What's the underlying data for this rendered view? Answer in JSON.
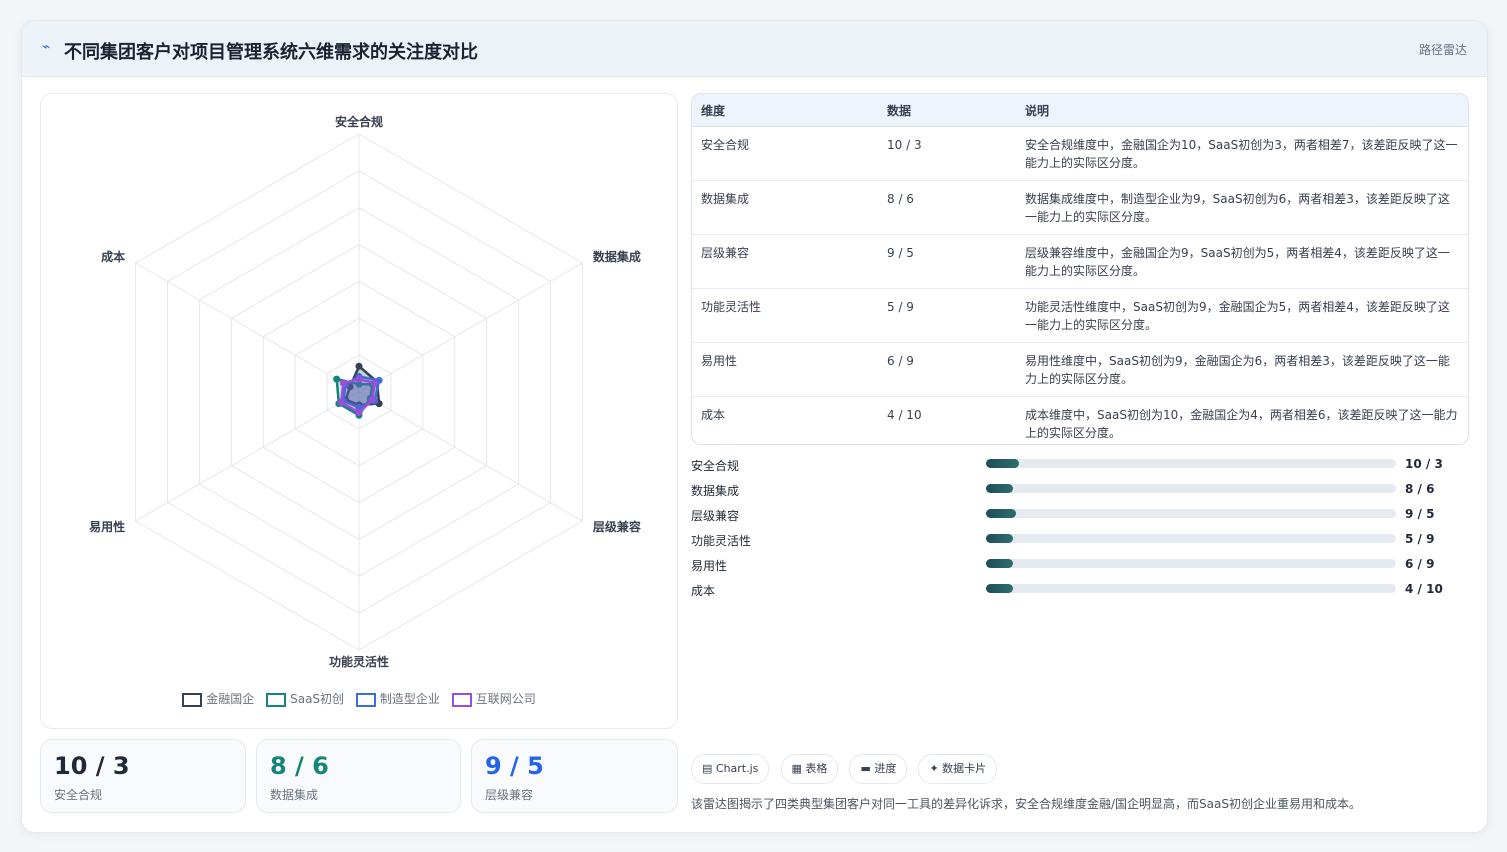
{
  "header": {
    "title": "不同集团客户对项目管理系统六维需求的关注度对比",
    "tag": "路径雷达",
    "icon": "chart-line-icon"
  },
  "chart_data": {
    "type": "radar",
    "axes": [
      "安全合规",
      "数据集成",
      "层级兼容",
      "功能灵活性",
      "易用性",
      "成本"
    ],
    "rmax": 100,
    "rings": 7,
    "series": [
      {
        "name": "金融国企",
        "color": "#334155",
        "values": [
          10,
          8,
          9,
          5,
          6,
          4
        ]
      },
      {
        "name": "SaaS初创",
        "color": "#14857a",
        "values": [
          3,
          6,
          5,
          9,
          9,
          10
        ]
      },
      {
        "name": "制造型企业",
        "color": "#3b6fd6",
        "values": [
          6,
          9,
          7,
          6,
          7,
          6
        ]
      },
      {
        "name": "互联网公司",
        "color": "#9b4ddb",
        "values": [
          5,
          7,
          6,
          8,
          8,
          7
        ]
      }
    ]
  },
  "table": {
    "headers": [
      "维度",
      "数据",
      "说明"
    ],
    "rows": [
      {
        "dim": "安全合规",
        "data": "10 / 3",
        "desc": "安全合规维度中，金融国企为10，SaaS初创为3，两者相差7，该差距反映了这一能力上的实际区分度。"
      },
      {
        "dim": "数据集成",
        "data": "8 / 6",
        "desc": "数据集成维度中，制造型企业为9，SaaS初创为6，两者相差3，该差距反映了这一能力上的实际区分度。"
      },
      {
        "dim": "层级兼容",
        "data": "9 / 5",
        "desc": "层级兼容维度中，金融国企为9，SaaS初创为5，两者相差4，该差距反映了这一能力上的实际区分度。"
      },
      {
        "dim": "功能灵活性",
        "data": "5 / 9",
        "desc": "功能灵活性维度中，SaaS初创为9，金融国企为5，两者相差4，该差距反映了这一能力上的实际区分度。"
      },
      {
        "dim": "易用性",
        "data": "6 / 9",
        "desc": "易用性维度中，SaaS初创为9，金融国企为6，两者相差3，该差距反映了这一能力上的实际区分度。"
      },
      {
        "dim": "成本",
        "data": "4 / 10",
        "desc": "成本维度中，SaaS初创为10，金融国企为4，两者相差6，该差距反映了这一能力上的实际区分度。"
      }
    ]
  },
  "bars": [
    {
      "label": "安全合规",
      "value": "10 / 3",
      "fill": 0.08
    },
    {
      "label": "数据集成",
      "value": "8 / 6",
      "fill": 0.065
    },
    {
      "label": "层级兼容",
      "value": "9 / 5",
      "fill": 0.072
    },
    {
      "label": "功能灵活性",
      "value": "5 / 9",
      "fill": 0.065
    },
    {
      "label": "易用性",
      "value": "6 / 9",
      "fill": 0.065
    },
    {
      "label": "成本",
      "value": "4 / 10",
      "fill": 0.065
    }
  ],
  "stats": [
    {
      "value": "10 / 3",
      "label": "安全合规",
      "color": "#1f2937"
    },
    {
      "value": "8 / 6",
      "label": "数据集成",
      "color": "#14857a"
    },
    {
      "value": "9 / 5",
      "label": "层级兼容",
      "color": "#2563eb"
    }
  ],
  "chips": [
    "▤ Chart.js",
    "▦ 表格",
    "▬ 进度",
    "✦ 数据卡片"
  ],
  "note": "该雷达图揭示了四类典型集团客户对同一工具的差异化诉求，安全合规维度金融/国企明显高，而SaaS初创企业重易用和成本。"
}
